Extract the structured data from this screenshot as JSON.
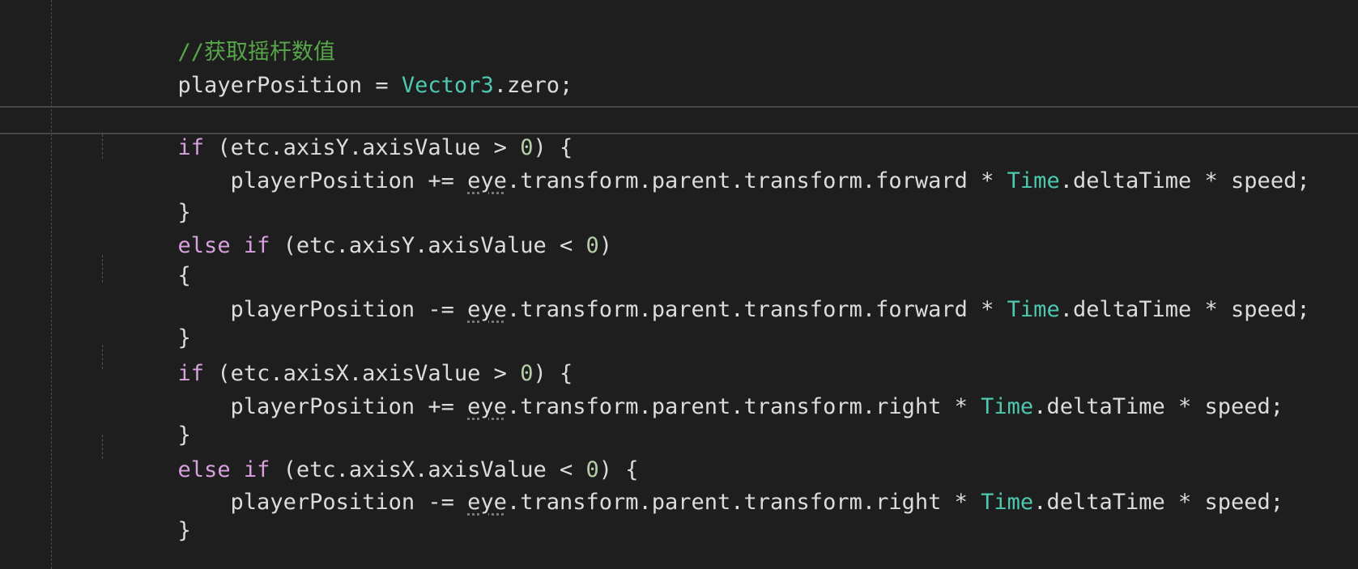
{
  "editor": {
    "lines": [
      {
        "text": "//获取摇杆数值"
      },
      {
        "var": "playerPosition",
        "eq": " = ",
        "type": "Vector3",
        "member": ".zero;"
      },
      {
        "kw": "if",
        "pre": " (etc.axisY.axisValue > ",
        "num": "0",
        "post": ") {"
      },
      {
        "var": "playerPosition",
        "op": " += ",
        "eye": "eye",
        "chain": ".transform.parent.transform.forward",
        "mul1": " * ",
        "type": "Time",
        "member": ".deltaTime",
        "mul2": " * ",
        "tail": "speed;"
      },
      {
        "brace": "}"
      },
      {
        "kw": "else if",
        "pre": " (etc.axisY.axisValue < ",
        "num": "0",
        "post": ")"
      },
      {
        "brace": "{"
      },
      {
        "var": "playerPosition",
        "op": " -= ",
        "eye": "eye",
        "chain": ".transform.parent.transform.forward",
        "mul1": " * ",
        "type": "Time",
        "member": ".deltaTime",
        "mul2": " * ",
        "tail": "speed;"
      },
      {
        "brace": "}"
      },
      {
        "kw": "if",
        "pre": " (etc.axisX.axisValue > ",
        "num": "0",
        "post": ") {"
      },
      {
        "var": "playerPosition",
        "op": " += ",
        "eye": "eye",
        "chain": ".transform.parent.transform.right",
        "mul1": " * ",
        "type": "Time",
        "member": ".deltaTime",
        "mul2": " * ",
        "tail": "speed;"
      },
      {
        "brace": "}"
      },
      {
        "kw": "else if",
        "pre": " (etc.axisX.axisValue < ",
        "num": "0",
        "post": ") {"
      },
      {
        "var": "playerPosition",
        "op": " -= ",
        "eye": "eye",
        "chain": ".transform.parent.transform.right",
        "mul1": " * ",
        "type": "Time",
        "member": ".deltaTime",
        "mul2": " * ",
        "tail": "speed;"
      },
      {
        "brace": "}"
      }
    ],
    "colors": {
      "background": "#1e1e1e",
      "comment": "#57a64a",
      "keyword": "#d8a0df",
      "type": "#4ec9b0",
      "number": "#b5cea8",
      "text": "#dcdcdc"
    }
  }
}
